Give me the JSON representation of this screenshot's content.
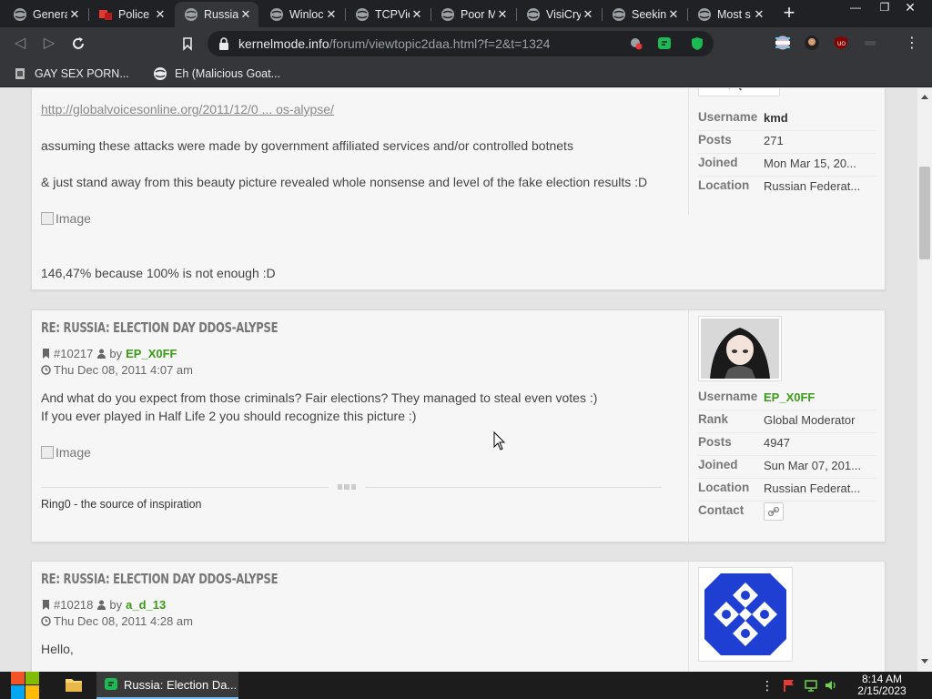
{
  "browser": {
    "tabs": [
      {
        "title": "Genera",
        "icon": "globe-icon",
        "active": false
      },
      {
        "title": "Police",
        "icon": "red-flag-icon",
        "active": false
      },
      {
        "title": "Russia",
        "icon": "globe-icon",
        "active": true
      },
      {
        "title": "Winloc",
        "icon": "globe-icon",
        "active": false
      },
      {
        "title": "TCPVie",
        "icon": "globe-icon",
        "active": false
      },
      {
        "title": "Poor M",
        "icon": "globe-icon",
        "active": false
      },
      {
        "title": "VisiCry",
        "icon": "globe-icon",
        "active": false
      },
      {
        "title": "Seekin",
        "icon": "globe-icon",
        "active": false
      },
      {
        "title": "Most s",
        "icon": "globe-icon",
        "active": false
      }
    ],
    "url_host": "kernelmode.info",
    "url_path": "/forum/viewtopic2daa.html?f=2&t=1324",
    "bookmarks": [
      {
        "label": "GAY SEX PORN...",
        "icon": "page-icon"
      },
      {
        "label": "Eh (Malicious Goat...",
        "icon": "globe-icon"
      }
    ]
  },
  "posts": [
    {
      "link": "http://globalvoicesonline.org/2011/12/0 ... os-alypse/",
      "line1": "assuming these attacks were made by government affiliated services and/or controlled botnets",
      "line2": "& just stand away from this beauty picture revealed whole nonsense and level of the fake election results :D",
      "image_alt": "Image",
      "line3": "146,47% because 100% is not enough :D",
      "profile": [
        {
          "key": "Username",
          "value": "kmd"
        },
        {
          "key": "Posts",
          "value": "271"
        },
        {
          "key": "Joined",
          "value": "Mon Mar 15, 20..."
        },
        {
          "key": "Location",
          "value": "Russian Federat..."
        }
      ]
    },
    {
      "title": "Re: Russia: Election Day DDoS-alypse",
      "post_id": "#10217",
      "by": "by",
      "author": "EP_X0FF",
      "date": "Thu Dec 08, 2011 4:07 am",
      "line1": "And what do you expect from those criminals? Fair elections? They managed to steal even votes :)",
      "line2": "If you ever played in Half Life 2 you should recognize this picture :)",
      "image_alt": "Image",
      "signature": "Ring0 - the source of inspiration",
      "profile": [
        {
          "key": "Username",
          "value": "EP_X0FF"
        },
        {
          "key": "Rank",
          "value": "Global Moderator"
        },
        {
          "key": "Posts",
          "value": "4947"
        },
        {
          "key": "Joined",
          "value": "Sun Mar 07, 201..."
        },
        {
          "key": "Location",
          "value": "Russian Federat..."
        },
        {
          "key": "Contact",
          "value": ""
        }
      ]
    },
    {
      "title": "Re: Russia: Election Day DDoS-alypse",
      "post_id": "#10218",
      "by": "by",
      "author": "a_d_13",
      "date": "Thu Dec 08, 2011 4:28 am",
      "line1": "Hello,"
    }
  ],
  "taskbar": {
    "app_title": "Russia: Election Da...",
    "time": "8:14 AM",
    "date": "2/15/2023"
  },
  "colors": {
    "accent_green": "#3c9a19",
    "avatar_blue": "#1f3fd3"
  }
}
